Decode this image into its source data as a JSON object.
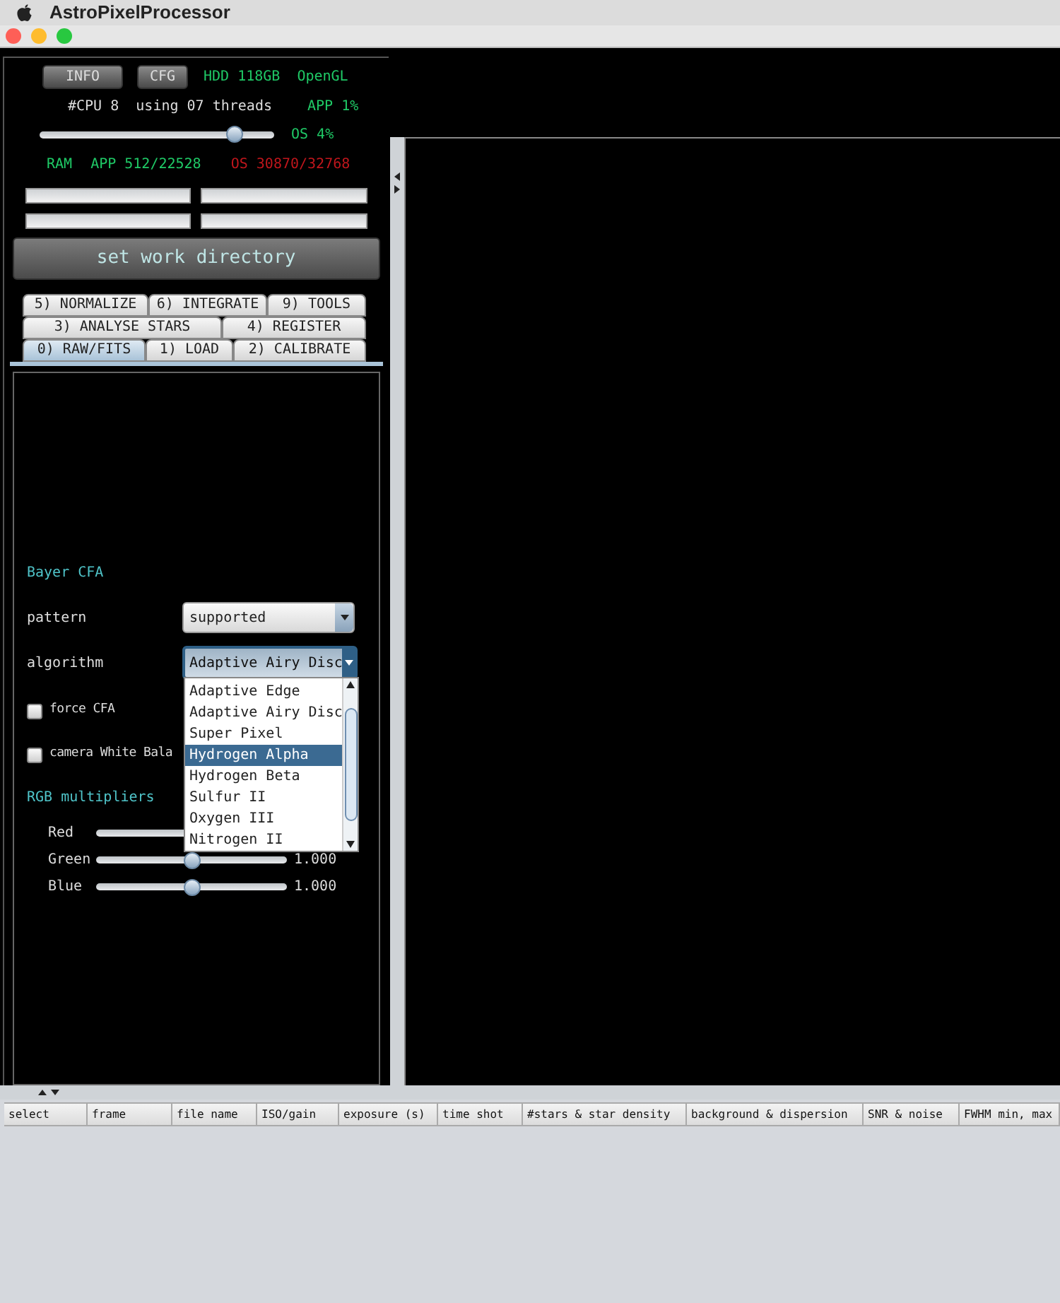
{
  "menu_bar": {
    "app_name": "AstroPixelProcessor"
  },
  "header": {
    "buttons": [
      "INFO",
      "CFG"
    ],
    "hdd": "HDD 118GB",
    "renderer": "OpenGL",
    "cpu": "#CPU 8  using 07 threads",
    "app_cpu": "APP 1%",
    "os_cpu": "OS 4%",
    "threads_slider": {
      "level": 0.83
    },
    "ram_label": "RAM",
    "ram_app": "APP 512/22528",
    "ram_os": "OS 30870/32768"
  },
  "progress_bars": [
    {
      "level": 0
    },
    {
      "level": 0
    },
    {
      "level": 0
    },
    {
      "level": 0
    }
  ],
  "work_directory_button": "set work directory",
  "tab_rows": [
    [
      {
        "label": "5) NORMALIZE",
        "selected": false
      },
      {
        "label": "6) INTEGRATE",
        "selected": false
      },
      {
        "label": "9) TOOLS",
        "selected": false
      }
    ],
    [
      {
        "label": "3) ANALYSE STARS",
        "selected": false
      },
      {
        "label": "4) REGISTER",
        "selected": false
      }
    ],
    [
      {
        "label": "0) RAW/FITS",
        "selected": true
      },
      {
        "label": "1) LOAD",
        "selected": false
      },
      {
        "label": "2) CALIBRATE",
        "selected": false
      }
    ]
  ],
  "bayer": {
    "title": "Bayer CFA",
    "pattern_label": "pattern",
    "pattern_value": "supported",
    "algorithm_label": "algorithm",
    "algorithm_value": "Adaptive Airy Disc",
    "algorithm_options": [
      {
        "label": "Adaptive Edge",
        "selected": false
      },
      {
        "label": "Adaptive Airy Disc",
        "selected": false
      },
      {
        "label": "Super Pixel",
        "selected": false
      },
      {
        "label": "Hydrogen Alpha",
        "selected": true
      },
      {
        "label": "Hydrogen Beta",
        "selected": false
      },
      {
        "label": "Sulfur II",
        "selected": false
      },
      {
        "label": "Oxygen III",
        "selected": false
      },
      {
        "label": "Nitrogen II",
        "selected": false
      }
    ],
    "checkboxes": [
      {
        "label": "force CFA",
        "checked": false
      },
      {
        "label": "camera White Bala",
        "checked": false
      }
    ],
    "rgb_title": "RGB multipliers",
    "multipliers": [
      {
        "name": "Red"
      },
      {
        "name": "Green",
        "level": 0.5,
        "reading": "1.000"
      },
      {
        "name": "Blue",
        "level": 0.5,
        "reading": "1.000"
      }
    ]
  },
  "table": {
    "columns": [
      "select",
      "frame",
      "file name",
      "ISO/gain",
      "exposure (s)",
      "time shot",
      "#stars & star density",
      "background & dispersion",
      "SNR & noise",
      "FWHM min, max"
    ]
  }
}
